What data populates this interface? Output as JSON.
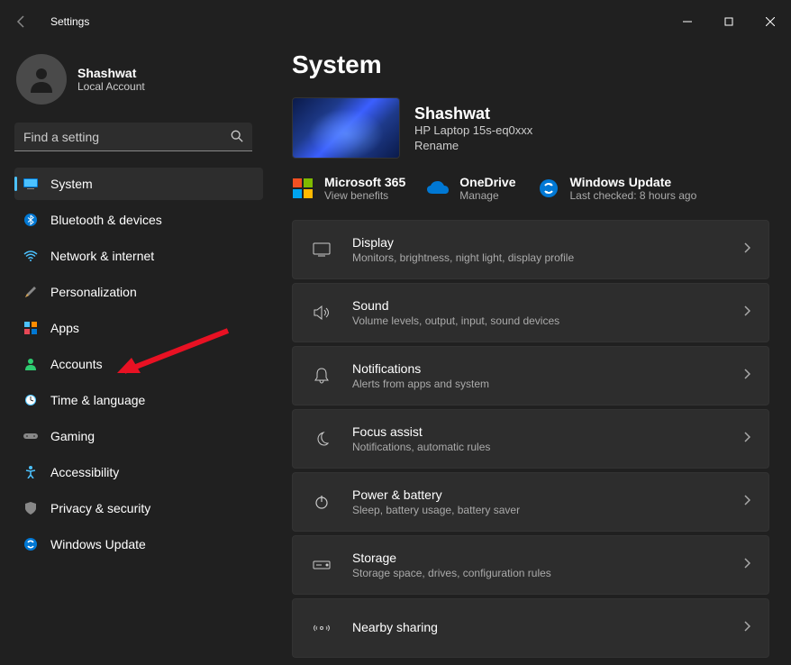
{
  "titlebar": {
    "title": "Settings"
  },
  "user": {
    "name": "Shashwat",
    "accountType": "Local Account"
  },
  "search": {
    "placeholder": "Find a setting"
  },
  "nav": [
    {
      "id": "system",
      "label": "System",
      "active": true
    },
    {
      "id": "bluetooth",
      "label": "Bluetooth & devices"
    },
    {
      "id": "network",
      "label": "Network & internet"
    },
    {
      "id": "personalization",
      "label": "Personalization"
    },
    {
      "id": "apps",
      "label": "Apps"
    },
    {
      "id": "accounts",
      "label": "Accounts"
    },
    {
      "id": "time",
      "label": "Time & language"
    },
    {
      "id": "gaming",
      "label": "Gaming"
    },
    {
      "id": "accessibility",
      "label": "Accessibility"
    },
    {
      "id": "privacy",
      "label": "Privacy & security"
    },
    {
      "id": "update",
      "label": "Windows Update"
    }
  ],
  "page": {
    "title": "System"
  },
  "device": {
    "name": "Shashwat",
    "model": "HP Laptop 15s-eq0xxx",
    "renameLabel": "Rename"
  },
  "services": {
    "ms365": {
      "title": "Microsoft 365",
      "sub": "View benefits"
    },
    "onedrive": {
      "title": "OneDrive",
      "sub": "Manage"
    },
    "update": {
      "title": "Windows Update",
      "sub": "Last checked: 8 hours ago"
    }
  },
  "settings": [
    {
      "id": "display",
      "title": "Display",
      "sub": "Monitors, brightness, night light, display profile"
    },
    {
      "id": "sound",
      "title": "Sound",
      "sub": "Volume levels, output, input, sound devices"
    },
    {
      "id": "notifications",
      "title": "Notifications",
      "sub": "Alerts from apps and system"
    },
    {
      "id": "focus",
      "title": "Focus assist",
      "sub": "Notifications, automatic rules"
    },
    {
      "id": "power",
      "title": "Power & battery",
      "sub": "Sleep, battery usage, battery saver"
    },
    {
      "id": "storage",
      "title": "Storage",
      "sub": "Storage space, drives, configuration rules"
    },
    {
      "id": "nearby",
      "title": "Nearby sharing",
      "sub": ""
    }
  ]
}
